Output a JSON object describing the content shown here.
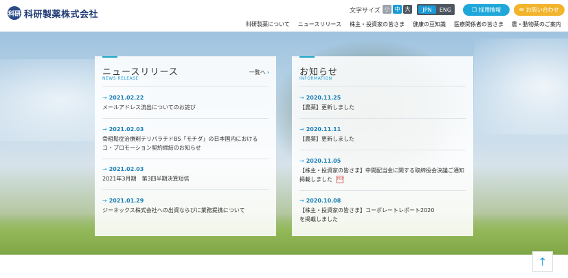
{
  "header": {
    "logo_mark": "科研",
    "company_name": "科研製薬株式会社",
    "font_size_label": "文字サイズ",
    "font_sizes": [
      "小",
      "中",
      "大"
    ],
    "lang_jpn": "JPN",
    "lang_eng": "ENG",
    "recruit_label": "採用情報",
    "contact_label": "お問い合わせ",
    "nav": [
      "科研製薬について",
      "ニュースリリース",
      "株主・投資家の皆さま",
      "健康の豆知識",
      "医療関係者の皆さま",
      "農・動物薬のご案内"
    ]
  },
  "news": {
    "title": "ニュースリリース",
    "subtitle": "NEWS RELEASE",
    "more_label": "一覧へ",
    "items": [
      {
        "date": "2021.02.22",
        "text": "メールアドレス流出についてのお詫び"
      },
      {
        "date": "2021.02.03",
        "text": "骨粗鬆症治療剤テリパラチドBS「モチダ」の日本国内における",
        "text2": "コ・プロモーション契約締結のお知らせ"
      },
      {
        "date": "2021.02.03",
        "text": "2021年3月期　第3四半期決算短信"
      },
      {
        "date": "2021.01.29",
        "text": "ジーネックス株式会社への出資ならびに業務提携について"
      }
    ]
  },
  "info": {
    "title": "お知らせ",
    "subtitle": "INFORMATION",
    "items": [
      {
        "date": "2020.11.25",
        "text": "【農薬】更新しました"
      },
      {
        "date": "2020.11.11",
        "text": "【農薬】更新しました"
      },
      {
        "date": "2020.11.05",
        "text": "【株主・投資家の皆さま】中間配当金に関する取締役会決議ご通知",
        "text2": "掲載しました"
      },
      {
        "date": "2020.10.08",
        "text": "【株主・投資家の皆さま】コーポレートレポート2020",
        "text2": "を掲載しました"
      }
    ]
  },
  "icons": {
    "pdf": "pdf-icon",
    "arrow": "arrow-right-icon",
    "to_top": "arrow-up-icon"
  },
  "colors": {
    "accent": "#1a9ad6",
    "contact": "#f1b42b",
    "brand": "#1f3a73"
  }
}
